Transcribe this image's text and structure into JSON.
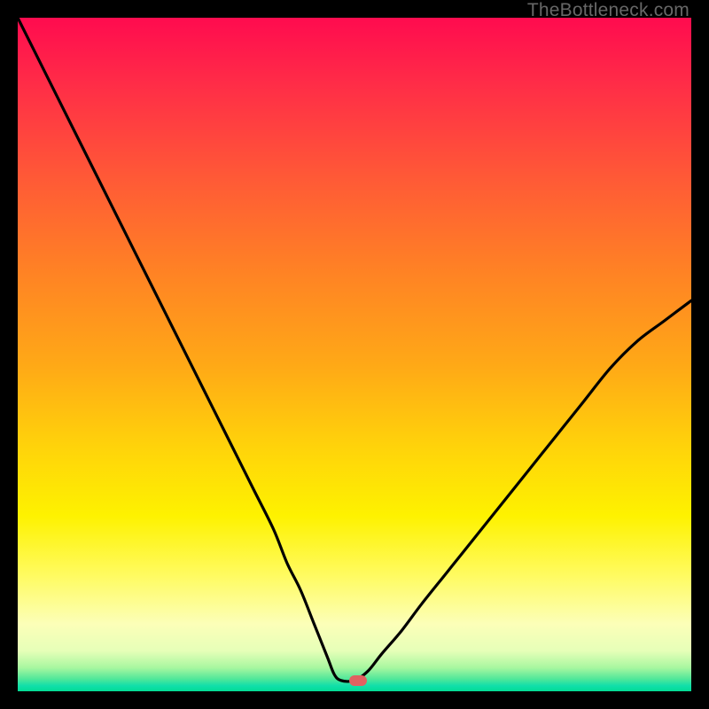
{
  "watermark": "TheBottleneck.com",
  "marker": {
    "x_pct": 50.5,
    "y_pct": 98.4
  },
  "chart_data": {
    "type": "line",
    "title": "",
    "xlabel": "",
    "ylabel": "",
    "xlim": [
      0,
      100
    ],
    "ylim": [
      0,
      100
    ],
    "grid": false,
    "legend": false,
    "note": "Axes unlabeled in source. x and y expressed as percent of plot area (0 = left/bottom, 100 = right/top). Curve is a V-shaped bottleneck profile with a flat minimum near x≈47–50.",
    "series": [
      {
        "name": "bottleneck-curve",
        "x": [
          0,
          4,
          8,
          12,
          16,
          20,
          23,
          26,
          29,
          32,
          35,
          38,
          40,
          42,
          44,
          46,
          47,
          48,
          50,
          52,
          54,
          57,
          60,
          64,
          68,
          72,
          76,
          80,
          84,
          88,
          92,
          96,
          100
        ],
        "y": [
          100,
          92,
          84,
          76,
          68,
          60,
          54,
          48,
          42,
          36,
          30,
          24,
          19,
          15,
          10,
          5,
          2.5,
          1.6,
          1.6,
          3,
          5.5,
          9,
          13,
          18,
          23,
          28,
          33,
          38,
          43,
          48,
          52,
          55,
          58
        ]
      }
    ],
    "marker_point": {
      "x": 50.5,
      "y": 1.6
    },
    "gradient_stops_pct_from_top": [
      {
        "pct": 0,
        "color": "#ff0b4f"
      },
      {
        "pct": 10,
        "color": "#ff2d47"
      },
      {
        "pct": 24,
        "color": "#ff5a36"
      },
      {
        "pct": 38,
        "color": "#ff8324"
      },
      {
        "pct": 52,
        "color": "#ffaa16"
      },
      {
        "pct": 64,
        "color": "#ffd40a"
      },
      {
        "pct": 74,
        "color": "#fef200"
      },
      {
        "pct": 83,
        "color": "#fffb63"
      },
      {
        "pct": 90,
        "color": "#fcffb8"
      },
      {
        "pct": 94,
        "color": "#e6ffb8"
      },
      {
        "pct": 96.5,
        "color": "#a8f7a0"
      },
      {
        "pct": 98.2,
        "color": "#4fe79a"
      },
      {
        "pct": 99.2,
        "color": "#10dfaa"
      },
      {
        "pct": 100,
        "color": "#03dc94"
      }
    ]
  }
}
